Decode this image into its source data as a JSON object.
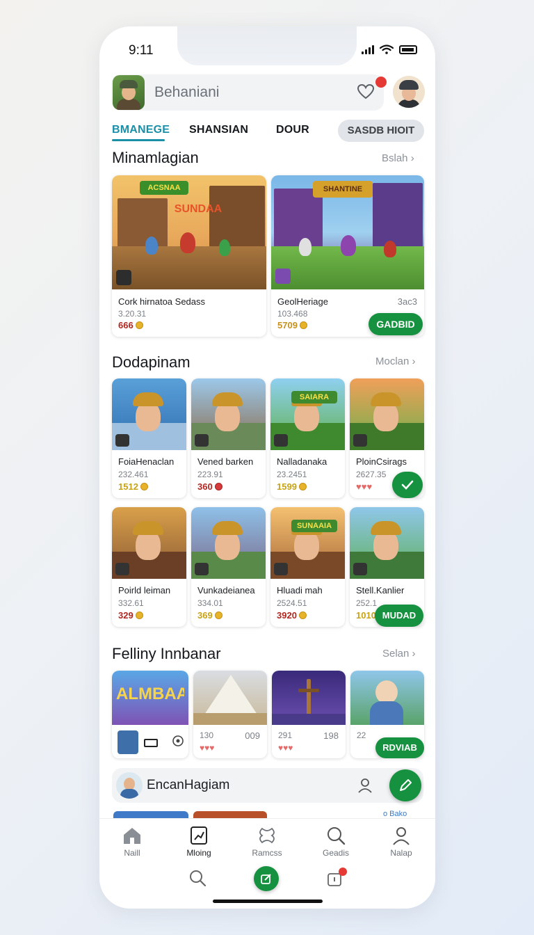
{
  "status": {
    "time": "9:11"
  },
  "header": {
    "search_text": "Behaniani",
    "notification_count": "",
    "icons": {
      "avatar": "player-avatar-icon",
      "favorite": "heart-outline-icon",
      "profile": "profile-avatar-icon"
    }
  },
  "tabs": [
    {
      "label": "BMANEGE",
      "active": true
    },
    {
      "label": "SHANSIAN",
      "active": false
    },
    {
      "label": "DOUR",
      "active": false
    },
    {
      "label": "SASDB HIOIT",
      "active": false
    }
  ],
  "sections": {
    "featured": {
      "title": "Minamlagian",
      "more": "Bslah",
      "cards": [
        {
          "name": "Cork hirnatoa Sedass",
          "sub": "3.20.31",
          "price": "666",
          "price_color": "#b1261f",
          "coin": "gold",
          "right": "",
          "banner": "ACSNAA",
          "banner2": "SUNDAA"
        },
        {
          "name": "GeolHeriage",
          "sub": "103.468",
          "price": "5709",
          "price_color": "#c7911c",
          "coin": "gold",
          "right": "3ac3",
          "banner": "SHANTINE",
          "button": "GADBID"
        }
      ]
    },
    "popular": {
      "title": "Dodapinam",
      "more": "Moclan",
      "cards": [
        {
          "name": "FoiaHenaclan",
          "sub": "232.461",
          "price": "1512",
          "price_color": "#c7a315",
          "coin": "gold"
        },
        {
          "name": "Vened barken",
          "sub": "223.91",
          "price": "360",
          "price_color": "#b1261f",
          "coin": "red"
        },
        {
          "name": "Nalladanaka",
          "sub": "23.2451",
          "price": "1599",
          "price_color": "#c7a315",
          "coin": "gold",
          "banner": "SAIARA"
        },
        {
          "name": "PloinCsirags",
          "sub": "2627.35",
          "price": "♥♥♥",
          "price_color": "#e56a6a",
          "coin": "none",
          "check": true
        },
        {
          "name": "Poirld leiman",
          "sub": "332.61",
          "price": "329",
          "price_color": "#b1261f",
          "coin": "gold"
        },
        {
          "name": "Vunkadeianea",
          "sub": "334.01",
          "price": "369",
          "price_color": "#c7a315",
          "coin": "gold"
        },
        {
          "name": "Hluadi mah",
          "sub": "2524.51",
          "price": "3920",
          "price_color": "#b1261f",
          "coin": "gold",
          "banner": "SUNAAIA"
        },
        {
          "name": "Stell.Kanlier",
          "sub": "252.1",
          "price": "1010",
          "price_color": "#c7a315",
          "coin": "gold",
          "button": "MUDAD"
        }
      ]
    },
    "recent": {
      "title": "Felliny Innbanar",
      "more": "Selan",
      "cards": [
        {
          "banner": "ALMBAA",
          "left": "",
          "right": ""
        },
        {
          "left": "130",
          "right": "009",
          "hearts": "♥♥♥"
        },
        {
          "left": "291",
          "right": "198",
          "hearts": "♥♥♥"
        },
        {
          "left": "22",
          "right": "",
          "hearts": "",
          "button": "RDVIAB"
        }
      ]
    }
  },
  "bottom_search": {
    "text": "EncanHagiam"
  },
  "nav": {
    "items": [
      {
        "label": "Naill",
        "icon": "home-icon"
      },
      {
        "label": "Mloing",
        "icon": "chart-icon"
      },
      {
        "label": "Ramcss",
        "icon": "puzzle-icon"
      },
      {
        "label": "Geadis",
        "icon": "search-icon"
      },
      {
        "label": "Nalap",
        "icon": "user-icon"
      }
    ],
    "peek_text": "o Bako",
    "secondary": {
      "badge": ""
    }
  },
  "colors": {
    "accent": "#1a8fa8",
    "green": "#16913f",
    "text": "#15181c"
  }
}
